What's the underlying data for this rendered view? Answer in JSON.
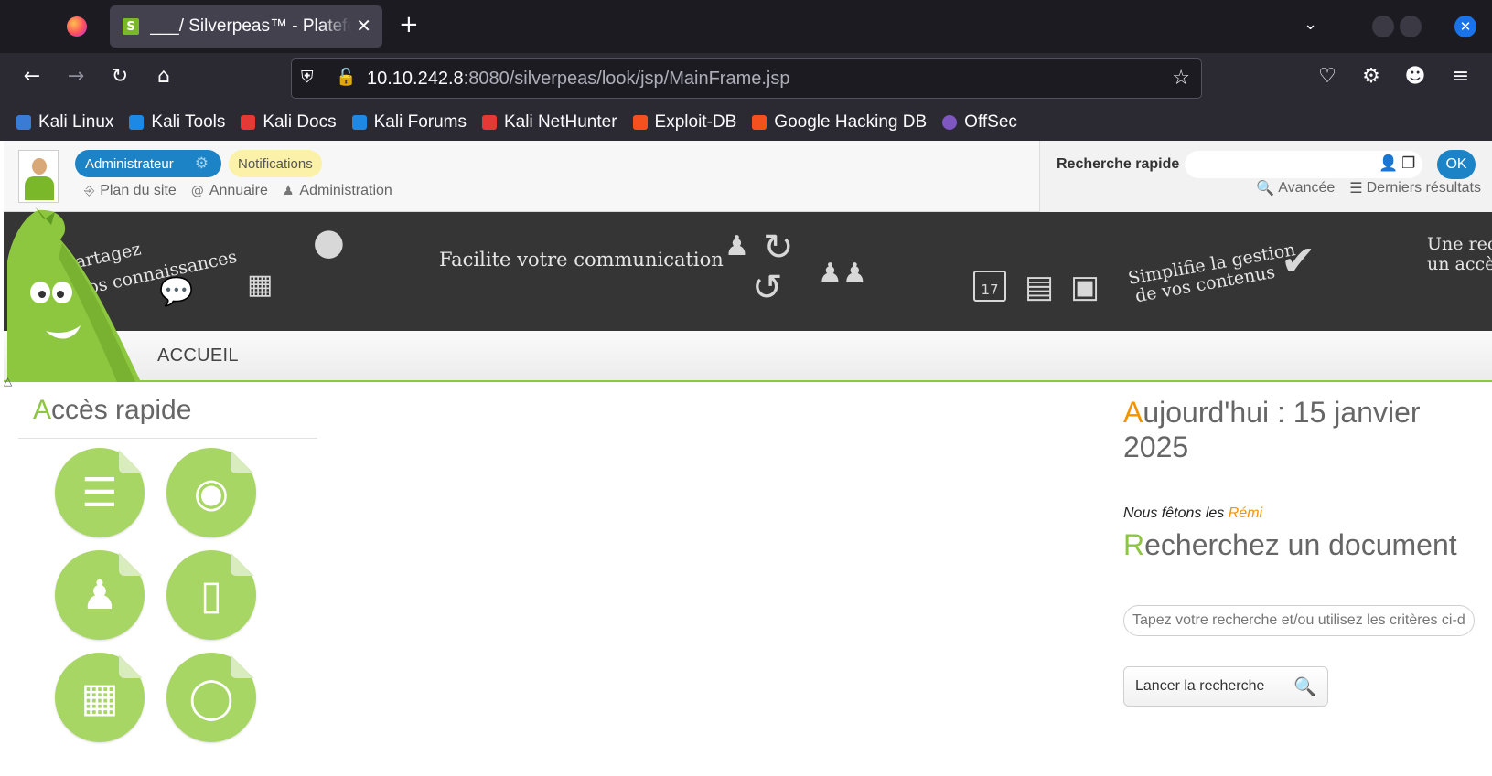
{
  "browser": {
    "tab_title": "___/ Silverpeas™ - Plateforme",
    "tab_close": "✕",
    "tab_new": "+",
    "url_host": "10.10.242.8",
    "url_rest": ":8080/silverpeas/look/jsp/MainFrame.jsp",
    "bookmarks": [
      {
        "label": "Kali Linux",
        "color": "#3a7bd5"
      },
      {
        "label": "Kali Tools",
        "color": "#1e88e5"
      },
      {
        "label": "Kali Docs",
        "color": "#e53935"
      },
      {
        "label": "Kali Forums",
        "color": "#1e88e5"
      },
      {
        "label": "Kali NetHunter",
        "color": "#e53935"
      },
      {
        "label": "Exploit-DB",
        "color": "#f4511e"
      },
      {
        "label": "Google Hacking DB",
        "color": "#f4511e"
      },
      {
        "label": "OffSec",
        "color": "#7e57c2"
      }
    ]
  },
  "header": {
    "user_role": "Administrateur",
    "notifications": "Notifications",
    "links": {
      "site_map": "Plan du site",
      "directory": "Annuaire",
      "admin": "Administration"
    },
    "quick_search": {
      "label": "Recherche rapide",
      "ok": "OK",
      "advanced": "Avancée",
      "last_results": "Derniers résultats"
    }
  },
  "banner": {
    "text1_line1": "Partagez",
    "text1_line2": "vos connaissances",
    "text2": "Facilite votre communication",
    "text3_line1": "Simplifie la gestion",
    "text3_line2": "de vos contenus",
    "text4_line1": "Une rec",
    "text4_line2": "un accè",
    "calendar_day": "17"
  },
  "menu": {
    "home": "ACCUEIL"
  },
  "quick_access": {
    "title_first": "A",
    "title_rest": "ccès rapide",
    "tiles": [
      "books-icon",
      "camera-icon",
      "users-icon",
      "clipboard-icon",
      "city-icon",
      "lightbulb-icon"
    ]
  },
  "today": {
    "title_first": "A",
    "title_rest": "ujourd'hui : 15 janvier 2025",
    "fete_prefix": "Nous fêtons les",
    "fete_name": "Rémi"
  },
  "doc_search": {
    "title_first": "R",
    "title_rest": "echerchez un document",
    "placeholder": "Tapez votre recherche et/ou utilisez les critères ci-dessous",
    "button": "Lancer la recherche"
  },
  "colors": {
    "accent_green": "#8dc63f",
    "accent_blue": "#1c84c6",
    "accent_orange": "#f29400"
  }
}
